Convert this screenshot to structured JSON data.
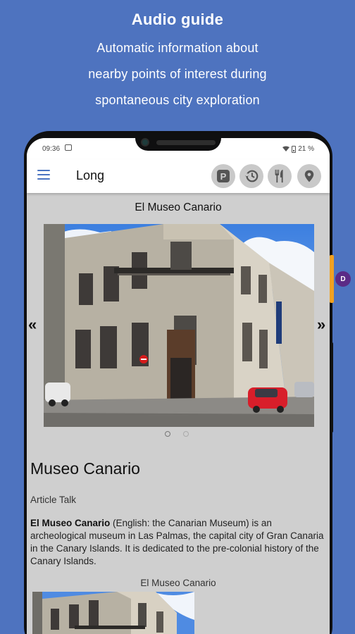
{
  "promo": {
    "title": "Audio guide",
    "line1": "Automatic information about",
    "line2": "nearby points of interest during",
    "line3": "spontaneous city exploration"
  },
  "side_badge": "D",
  "status_bar": {
    "time": "09:36",
    "battery": "21 %"
  },
  "app_bar": {
    "title": "Long",
    "actions": [
      "parking-icon",
      "history-icon",
      "restaurant-icon",
      "location-pin-icon"
    ]
  },
  "gallery": {
    "caption": "El Museo Canario",
    "prev_arrow": "«",
    "next_arrow": "»",
    "page_count": 2,
    "current_page": 1
  },
  "article": {
    "title": "Museo Canario",
    "tabs": "Article Talk",
    "lead_bold": "El Museo Canario",
    "lead_rest": " (English: the Canarian Museum) is an archeological museum in Las Palmas, the capital city of Gran Canaria in the Canary Islands. It is dedicated to the pre-colonial history of the Canary Islands.",
    "figure_caption": "El Museo Canario"
  },
  "colors": {
    "background": "#4e73bf",
    "screen": "#cfcfcf",
    "accent": "#4a74c2",
    "badge": "#5b2b86"
  }
}
